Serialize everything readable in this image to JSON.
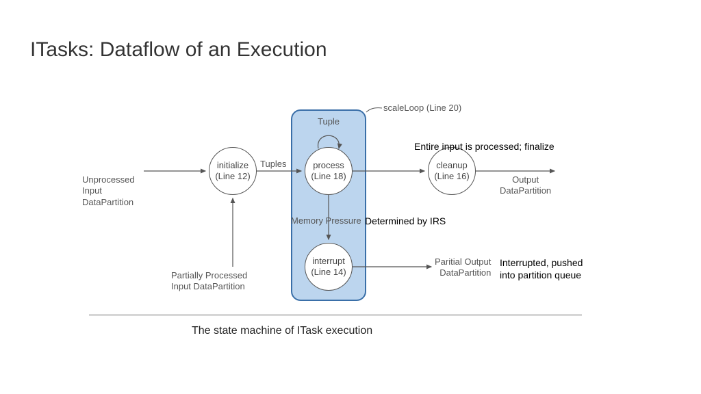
{
  "title": "ITasks: Dataflow of an Execution",
  "nodes": {
    "initialize": {
      "name": "initialize",
      "line": "(Line 12)"
    },
    "process": {
      "name": "process",
      "line": "(Line 18)"
    },
    "cleanup": {
      "name": "cleanup",
      "line": "(Line 16)"
    },
    "interrupt": {
      "name": "interrupt",
      "line": "(Line 14)"
    }
  },
  "edges": {
    "tuples": "Tuples",
    "tuple_self": "Tuple",
    "memory_pressure": "Memory Pressure",
    "scale_loop": "scaleLoop (Line 20)"
  },
  "labels": {
    "unprocessed": "Unprocessed\nInput\nDataPartition",
    "partially_processed": "Partially Processed\nInput DataPartition",
    "output_dp": "Output\nDataPartition",
    "partial_output": "Paritial Output\nDataPartition"
  },
  "annotations": {
    "finalize": "Entire input is processed; finalize",
    "irs": "Determined by IRS",
    "interrupted": "Interrupted, pushed\ninto partition queue"
  },
  "caption": "The state machine of ITask execution"
}
